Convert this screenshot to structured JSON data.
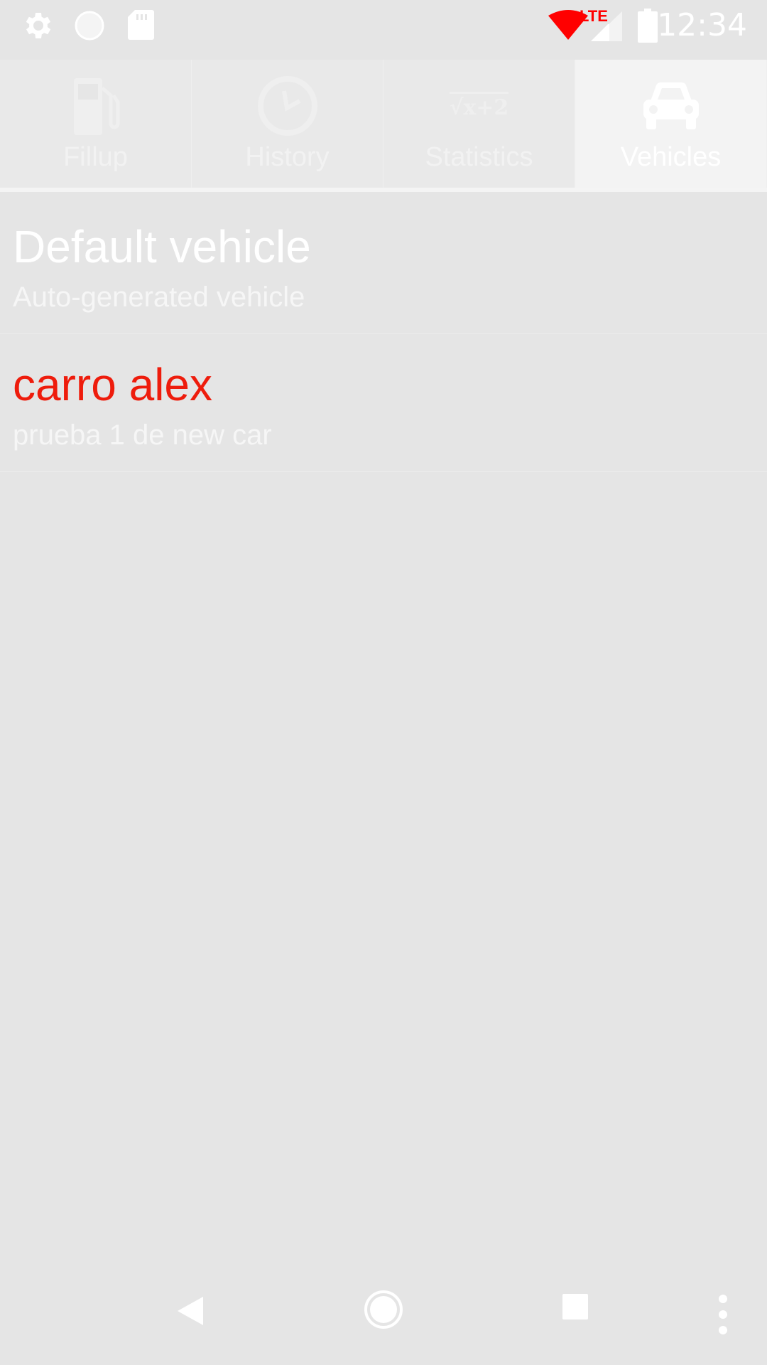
{
  "status_bar": {
    "time": "12:34",
    "icons": [
      "settings-icon",
      "circle-icon",
      "sd-card-icon",
      "wifi-icon",
      "signal-icon",
      "battery-icon"
    ],
    "network_label": "LTE",
    "colors": {
      "wifi": "#ff0000",
      "network_label": "#ff0000"
    }
  },
  "tabs": [
    {
      "label": "Fillup",
      "icon": "fuel-pump-icon",
      "active": false
    },
    {
      "label": "History",
      "icon": "clock-icon",
      "active": false
    },
    {
      "label": "Statistics",
      "icon": "sqrt-icon",
      "active": false
    },
    {
      "label": "Vehicles",
      "icon": "car-icon",
      "active": true
    }
  ],
  "statistics_icon_text": "√x+2",
  "vehicles": [
    {
      "name": "Default vehicle",
      "description": "Auto-generated vehicle",
      "highlighted": false
    },
    {
      "name": "carro alex",
      "description": "prueba 1 de new car",
      "highlighted": true
    }
  ],
  "colors": {
    "background": "#e5e5e5",
    "highlight_text": "#ee1c0c",
    "text": "#ffffff"
  },
  "nav_bar": {
    "buttons": [
      "back-icon",
      "home-icon",
      "recents-icon",
      "overflow-menu-icon"
    ]
  }
}
